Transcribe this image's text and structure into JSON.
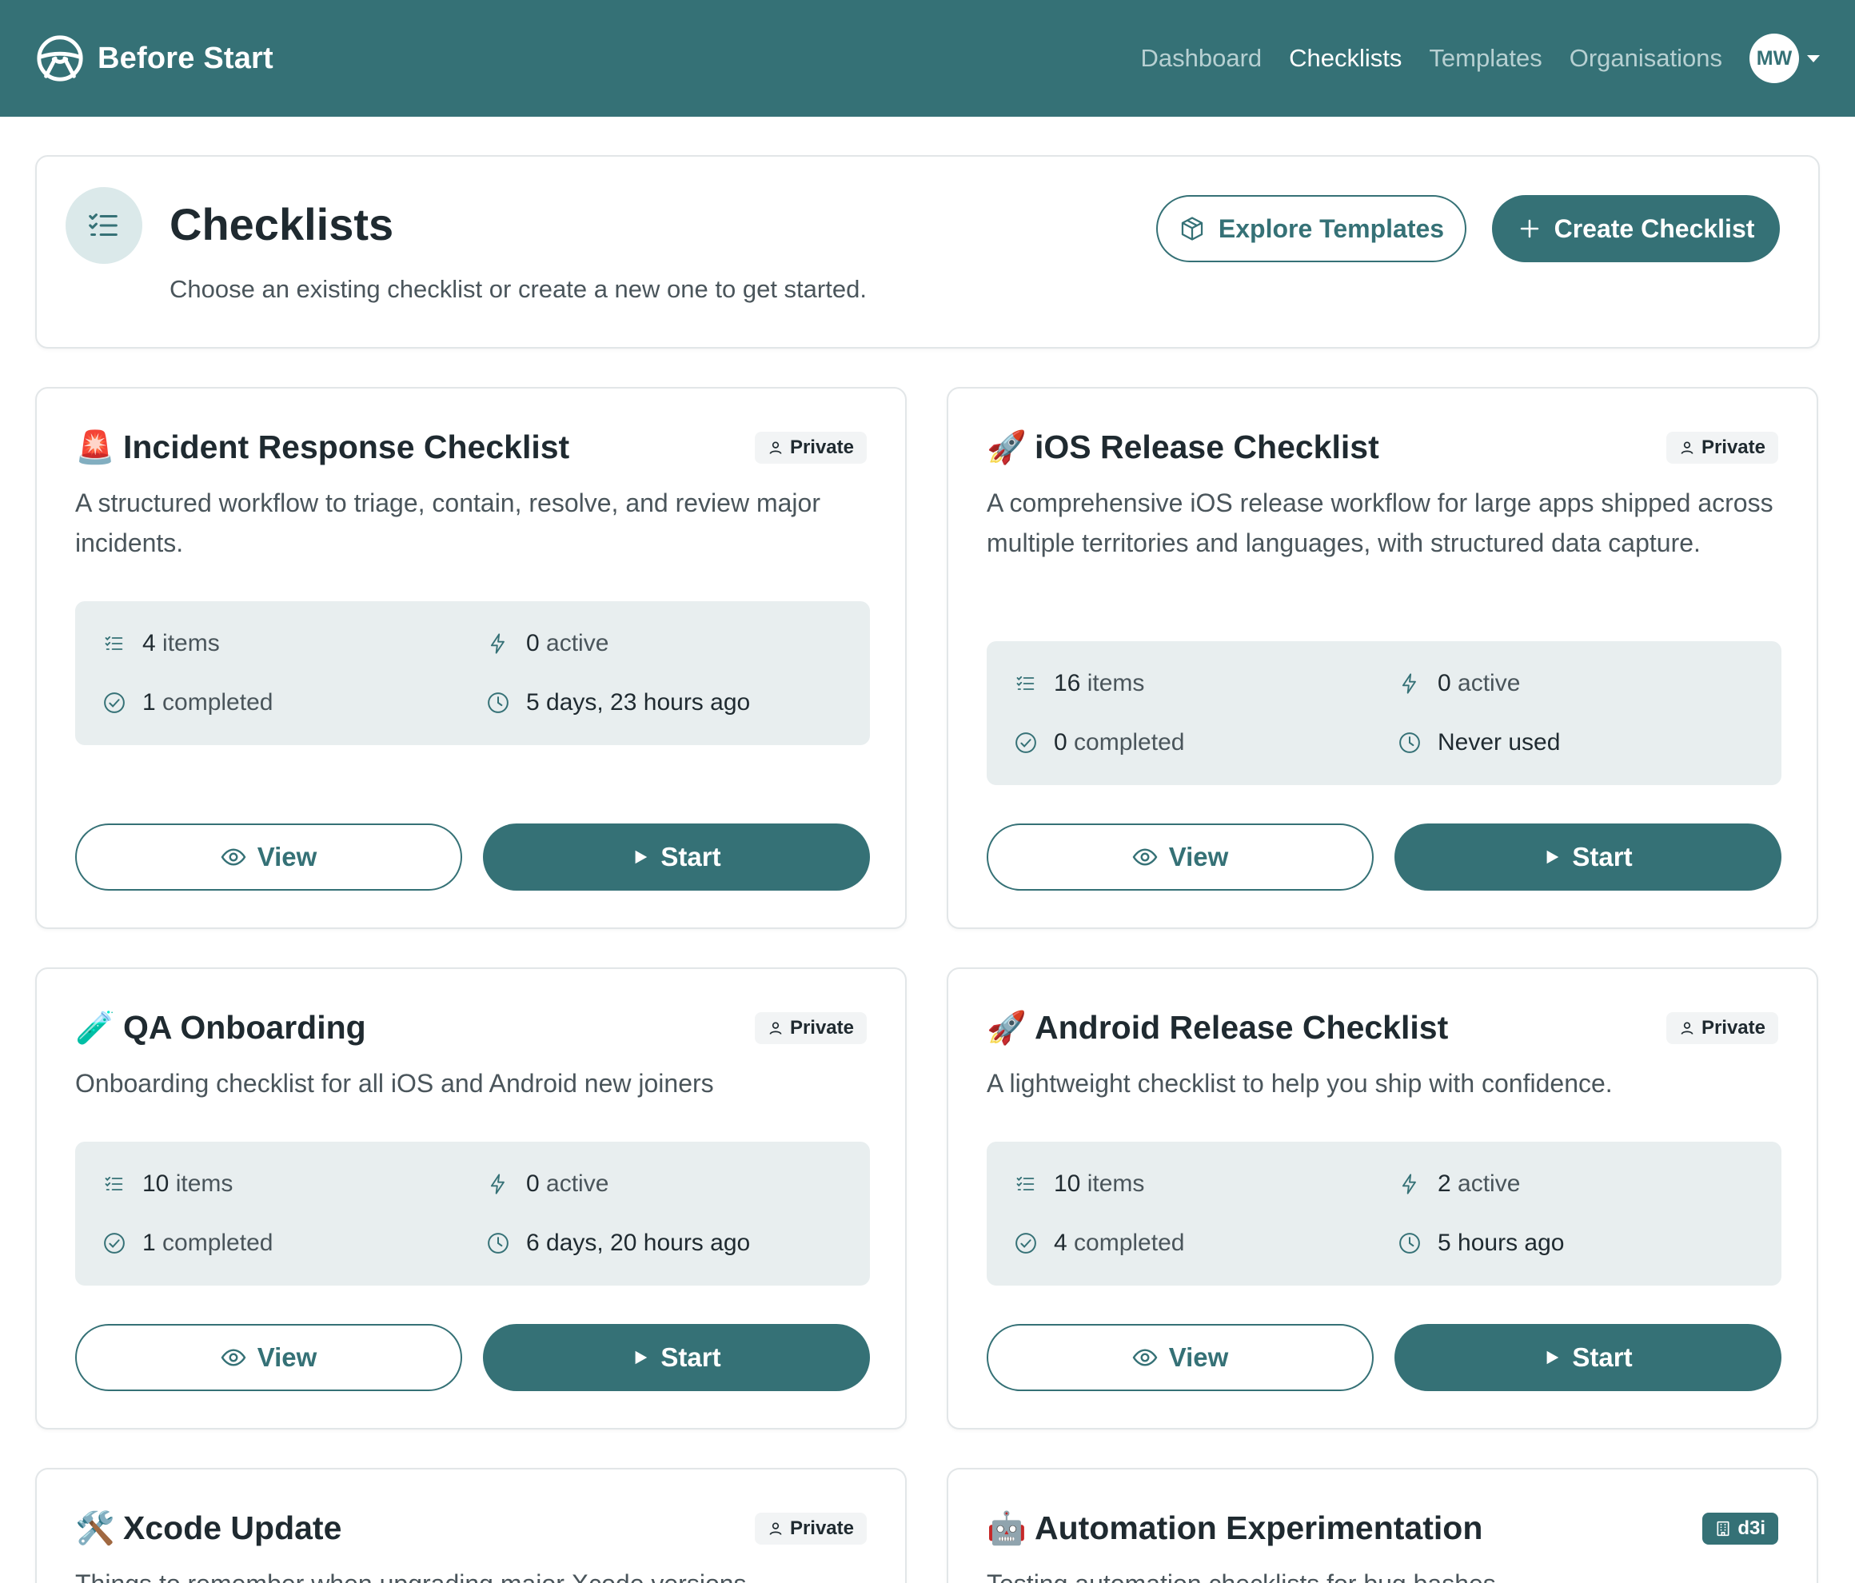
{
  "app": {
    "name": "Before Start"
  },
  "nav": {
    "links": [
      {
        "label": "Dashboard",
        "active": false
      },
      {
        "label": "Checklists",
        "active": true
      },
      {
        "label": "Templates",
        "active": false
      },
      {
        "label": "Organisations",
        "active": false
      }
    ],
    "user_initials": "MW"
  },
  "header": {
    "title": "Checklists",
    "subtitle": "Choose an existing checklist or create a new one to get started.",
    "explore_label": "Explore Templates",
    "create_label": "Create Checklist"
  },
  "cards": [
    {
      "emoji": "🚨",
      "name": "Incident Response Checklist",
      "badge": "Private",
      "description": "A structured workflow to triage, contain, resolve, and review major incidents.",
      "items_num": "4",
      "items_label": "items",
      "active_num": "0",
      "active_label": "active",
      "completed_num": "1",
      "completed_label": "completed",
      "last_used": "5 days, 23 hours ago",
      "view_label": "View",
      "start_label": "Start"
    },
    {
      "emoji": "🚀",
      "name": "iOS Release Checklist",
      "badge": "Private",
      "description": "A comprehensive iOS release workflow for large apps shipped across multiple territories and languages, with structured data capture.",
      "items_num": "16",
      "items_label": "items",
      "active_num": "0",
      "active_label": "active",
      "completed_num": "0",
      "completed_label": "completed",
      "last_used": "Never used",
      "view_label": "View",
      "start_label": "Start"
    },
    {
      "emoji": "🧪",
      "name": "QA Onboarding",
      "badge": "Private",
      "description": "Onboarding checklist for all iOS and Android new joiners",
      "items_num": "10",
      "items_label": "items",
      "active_num": "0",
      "active_label": "active",
      "completed_num": "1",
      "completed_label": "completed",
      "last_used": "6 days, 20 hours ago",
      "view_label": "View",
      "start_label": "Start"
    },
    {
      "emoji": "🚀",
      "name": "Android Release Checklist",
      "badge": "Private",
      "description": "A lightweight checklist to help you ship with confidence.",
      "items_num": "10",
      "items_label": "items",
      "active_num": "2",
      "active_label": "active",
      "completed_num": "4",
      "completed_label": "completed",
      "last_used": "5 hours ago",
      "view_label": "View",
      "start_label": "Start"
    },
    {
      "emoji": "🛠️",
      "name": "Xcode Update",
      "badge": "Private",
      "description": "Things to remember when upgrading major Xcode versions"
    },
    {
      "emoji": "🤖",
      "name": "Automation Experimentation",
      "badge": "d3i",
      "description": "Testing automation checklists for bug bashes"
    }
  ],
  "colors": {
    "primary": "#357176",
    "stats_bg": "#e8eeef",
    "border": "#e2e6e8"
  }
}
